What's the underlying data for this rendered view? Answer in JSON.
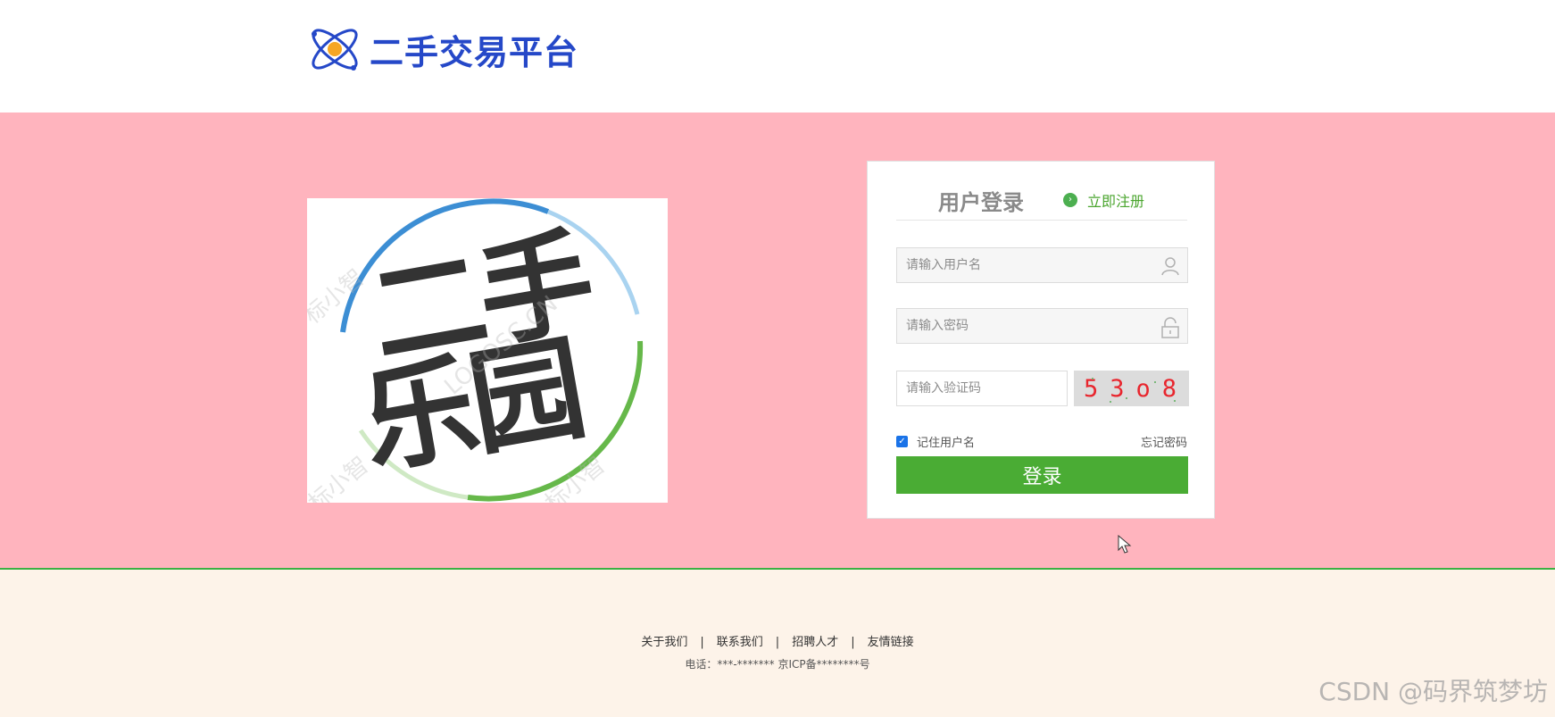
{
  "header": {
    "logo_text": "二手交易平台"
  },
  "promo": {
    "title_line1": "二手",
    "title_line2": "乐园",
    "watermarks": [
      "标小智",
      "LOGOSC.CN",
      "标小智",
      "标小智"
    ]
  },
  "login": {
    "title": "用户登录",
    "register_label": "立即注册",
    "username_placeholder": "请输入用户名",
    "password_placeholder": "请输入密码",
    "captcha_placeholder": "请输入验证码",
    "captcha_code": "53o8",
    "remember_label": "记住用户名",
    "remember_checked": true,
    "forgot_label": "忘记密码",
    "submit_label": "登录"
  },
  "footer": {
    "links": [
      "关于我们",
      "联系我们",
      "招聘人才",
      "友情链接"
    ],
    "separator": "|",
    "info": "电话：***-******* 京ICP备********号"
  },
  "watermark": "CSDN @码界筑梦坊",
  "colors": {
    "brand_blue": "#2548c8",
    "main_bg": "#ffb4be",
    "accent_green": "#4aac34",
    "footer_bg": "#fdf3e9"
  }
}
